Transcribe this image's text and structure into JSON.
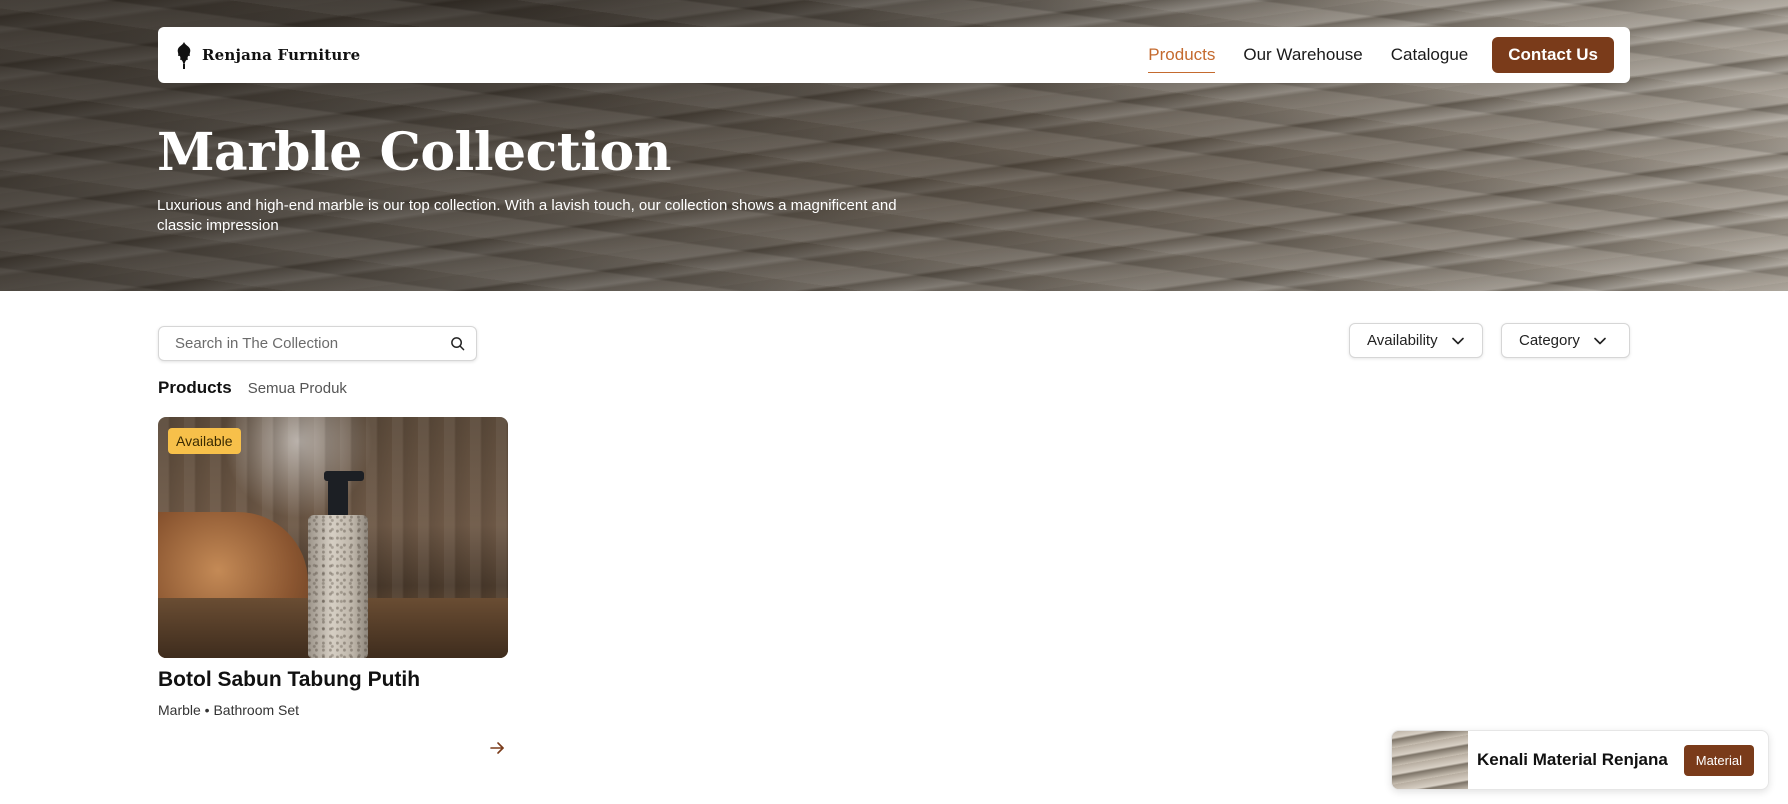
{
  "brand": {
    "name": "Renjana Furniture",
    "logo_icon": "flower-crest-icon"
  },
  "nav": {
    "items": [
      {
        "label": "Products",
        "active": true
      },
      {
        "label": "Our Warehouse",
        "active": false
      },
      {
        "label": "Catalogue",
        "active": false
      }
    ],
    "contact_label": "Contact Us"
  },
  "hero": {
    "title": "Marble Collection",
    "subtitle": "Luxurious and high-end marble is our top collection. With a lavish touch, our collection shows a magnificent and classic impression"
  },
  "search": {
    "placeholder": "Search in The Collection",
    "value": ""
  },
  "filters": {
    "availability_label": "Availability",
    "category_label": "Category"
  },
  "breadcrumb": {
    "main": "Products",
    "sub": "Semua Produk"
  },
  "products": [
    {
      "badge": "Available",
      "title": "Botol Sabun Tabung Putih",
      "meta": "Marble • Bathroom Set"
    }
  ],
  "material_promo": {
    "text": "Kenali Material Renjana",
    "button_label": "Material"
  },
  "colors": {
    "accent": "#c46a2e",
    "brand_brown": "#7a3b1a",
    "badge_yellow": "#f7c04a"
  }
}
